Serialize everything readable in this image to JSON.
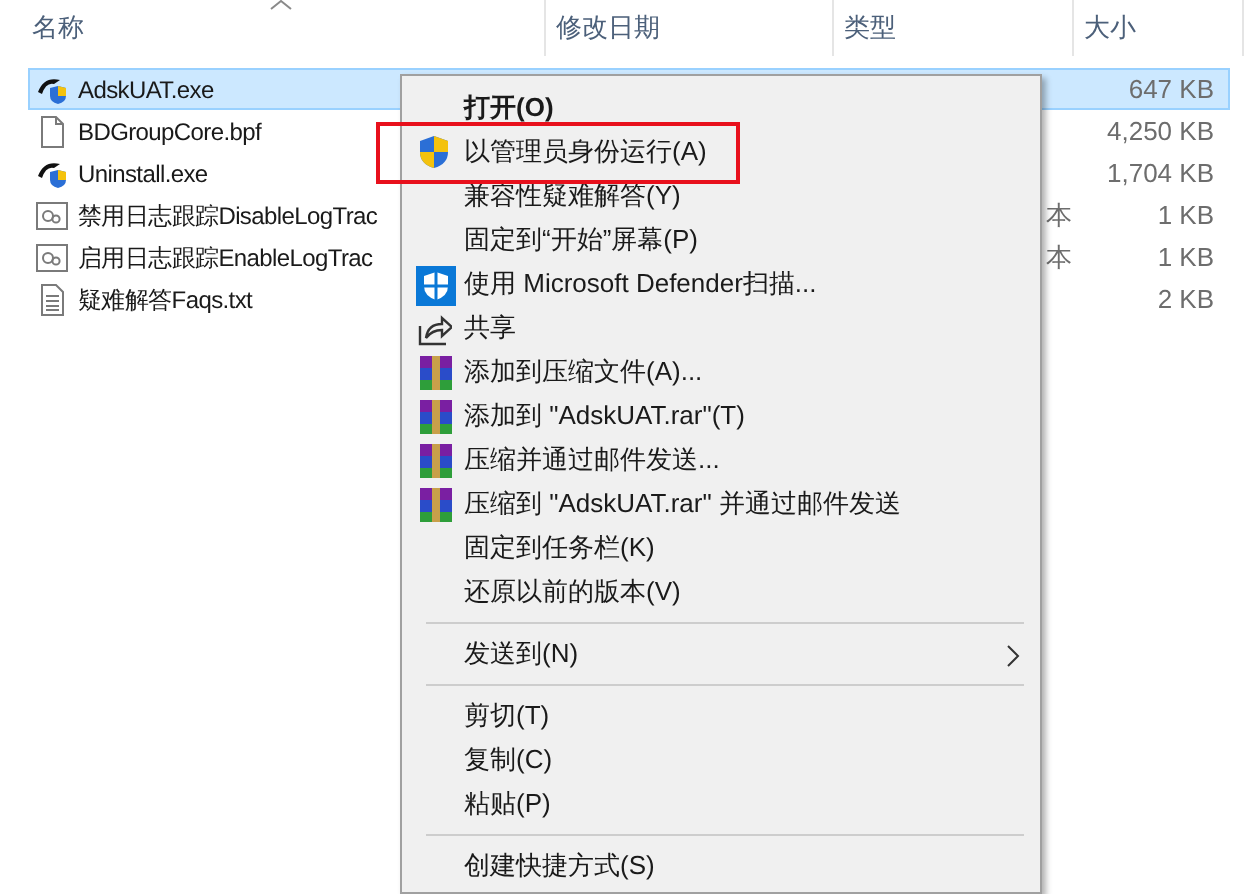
{
  "columns": [
    {
      "label": "名称",
      "sorted": true
    },
    {
      "label": "修改日期",
      "sorted": false
    },
    {
      "label": "类型",
      "sorted": false
    },
    {
      "label": "大小",
      "sorted": false
    }
  ],
  "files": [
    {
      "name": "AdskUAT.exe",
      "kind": "exe",
      "selected": true,
      "size": "647 KB"
    },
    {
      "name": "BDGroupCore.bpf",
      "kind": "file",
      "selected": false,
      "size": "4,250 KB"
    },
    {
      "name": "Uninstall.exe",
      "kind": "exe",
      "selected": false,
      "size": "1,704 KB"
    },
    {
      "name": "禁用日志跟踪DisableLogTrac",
      "kind": "config",
      "selected": false,
      "type": "本",
      "size": "1 KB"
    },
    {
      "name": "启用日志跟踪EnableLogTrac",
      "kind": "config",
      "selected": false,
      "type": "本",
      "size": "1 KB"
    },
    {
      "name": "疑难解答Faqs.txt",
      "kind": "text",
      "selected": false,
      "size": "2 KB"
    }
  ],
  "menu": {
    "items": [
      {
        "kind": "item",
        "label": "打开(O)",
        "default": true,
        "marked": false
      },
      {
        "kind": "shield",
        "label": "以管理员身份运行(A)",
        "default": false,
        "marked": true
      },
      {
        "kind": "item",
        "label": "兼容性疑难解答(Y)",
        "default": false,
        "marked": false
      },
      {
        "kind": "item",
        "label": "固定到“开始”屏幕(P)",
        "default": false,
        "marked": false
      },
      {
        "kind": "defender",
        "label": "使用 Microsoft Defender扫描...",
        "default": false,
        "marked": false
      },
      {
        "kind": "share",
        "label": "共享",
        "default": false,
        "marked": false
      },
      {
        "kind": "archive",
        "label": "添加到压缩文件(A)...",
        "default": false,
        "marked": false
      },
      {
        "kind": "archive",
        "label": "添加到 \"AdskUAT.rar\"(T)",
        "default": false,
        "marked": false
      },
      {
        "kind": "archive",
        "label": "压缩并通过邮件发送...",
        "default": false,
        "marked": false
      },
      {
        "kind": "archive",
        "label": "压缩到 \"AdskUAT.rar\" 并通过邮件发送",
        "default": false,
        "marked": false
      },
      {
        "kind": "item",
        "label": "固定到任务栏(K)",
        "default": false,
        "marked": false
      },
      {
        "kind": "item",
        "label": "还原以前的版本(V)",
        "default": false,
        "marked": false
      },
      {
        "kind": "separator"
      },
      {
        "kind": "item",
        "label": "发送到(N)",
        "submenu": true,
        "default": false,
        "marked": false
      },
      {
        "kind": "separator"
      },
      {
        "kind": "item",
        "label": "剪切(T)",
        "default": false,
        "marked": false
      },
      {
        "kind": "item",
        "label": "复制(C)",
        "default": false,
        "marked": false
      },
      {
        "kind": "item",
        "label": "粘贴(P)",
        "default": false,
        "marked": false
      },
      {
        "kind": "separator"
      },
      {
        "kind": "item",
        "label": "创建快捷方式(S)",
        "default": false,
        "marked": false
      }
    ]
  }
}
